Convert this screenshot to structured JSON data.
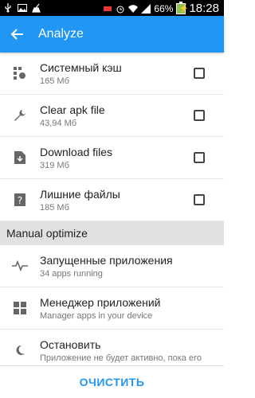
{
  "status_bar": {
    "battery_percent": "66%",
    "time": "18:28"
  },
  "app_bar": {
    "title": "Analyze"
  },
  "cache_items": [
    {
      "title": "Системный кэш",
      "subtitle": "165 Мб",
      "icon": "gear-grid-icon",
      "checked": false
    },
    {
      "title": "Clear apk file",
      "subtitle": "43,94 Мб",
      "icon": "wrench-icon",
      "checked": false
    },
    {
      "title": "Download files",
      "subtitle": "319 Мб",
      "icon": "download-file-icon",
      "checked": false
    },
    {
      "title": "Лишние файлы",
      "subtitle": "185 Мб",
      "icon": "question-file-icon",
      "checked": false
    }
  ],
  "section": {
    "label": "Manual optimize"
  },
  "manual_items": [
    {
      "title": "Запущенные приложения",
      "subtitle": "34 apps running",
      "icon": "activity-icon"
    },
    {
      "title": "Менеджер приложений",
      "subtitle": "Manager apps in your device",
      "icon": "apps-grid-icon"
    },
    {
      "title": "Остановить",
      "subtitle": "Приложение не будет активно, пока его",
      "icon": "moon-icon"
    }
  ],
  "bottom": {
    "button_label": "ОЧИСТИТЬ"
  },
  "colors": {
    "primary": "#2196f3"
  }
}
